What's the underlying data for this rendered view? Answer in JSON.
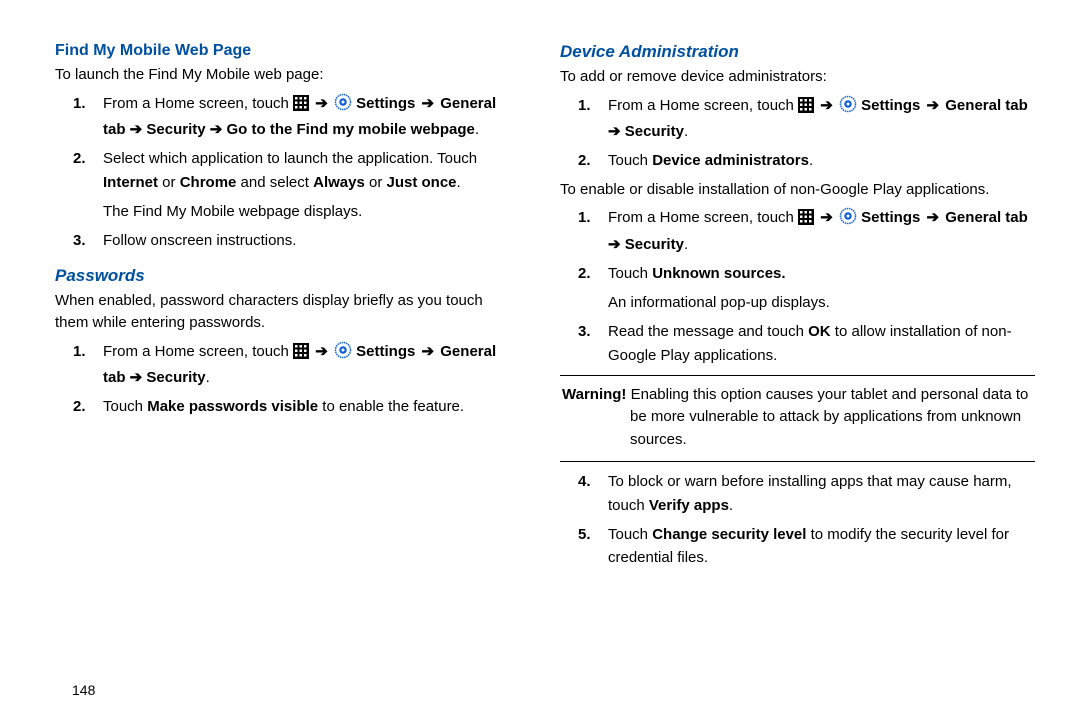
{
  "page_number": "148",
  "left": {
    "heading_blue": "Find My Mobile Web Page",
    "intro": "To launch the Find My Mobile web page:",
    "step1_pre": "From a Home screen, touch ",
    "step1_settings": " Settings ",
    "step1_rest": "General tab ➔ Security ➔ Go to the Find my mobile webpage",
    "step2_a": "Select which application to launch the application. Touch ",
    "step2_b": "Internet",
    "step2_c": " or ",
    "step2_d": "Chrome",
    "step2_e": " and select ",
    "step2_f": "Always",
    "step2_g": " or ",
    "step2_h": "Just once",
    "step2_after": "The Find My Mobile webpage displays.",
    "step3": "Follow onscreen instructions.",
    "passwords_heading": "Passwords",
    "passwords_intro": "When enabled, password characters display briefly as you touch them while entering passwords.",
    "pw_step1_pre": "From a Home screen, touch ",
    "pw_step1_settings": " Settings ",
    "pw_step1_rest": "General tab ➔ Security",
    "pw_step2_a": "Touch ",
    "pw_step2_b": "Make passwords visible",
    "pw_step2_c": " to enable the feature."
  },
  "right": {
    "heading": "Device Administration",
    "intro1": "To add or remove device administrators:",
    "da_step1_pre": "From a Home screen, touch ",
    "da_step1_settings": " Settings ",
    "da_step1_rest": "General tab ➔ Security",
    "da_step2_a": "Touch ",
    "da_step2_b": "Device administrators",
    "intro2": "To enable or disable installation of non-Google Play applications.",
    "ng_step1_pre": "From a Home screen, touch ",
    "ng_step1_settings": " Settings ",
    "ng_step1_rest": "General tab ➔ Security",
    "ng_step2_a": "Touch ",
    "ng_step2_b": "Unknown sources.",
    "ng_step2_after": "An informational pop-up displays.",
    "ng_step3_a": "Read the message and touch ",
    "ng_step3_b": "OK",
    "ng_step3_c": " to allow installation of non-Google Play applications.",
    "warning_label": "Warning!",
    "warning_text": " Enabling this option causes your tablet and personal data to be more vulnerable to attack by applications from unknown sources.",
    "ng_step4_a": "To block or warn before installing apps that may cause harm, touch ",
    "ng_step4_b": "Verify apps",
    "ng_step5_a": "Touch ",
    "ng_step5_b": "Change security level",
    "ng_step5_c": " to modify the security level for credential files."
  },
  "icons": {
    "apps": "apps-grid-icon",
    "settings": "settings-gear-icon",
    "arrow": "➔"
  }
}
